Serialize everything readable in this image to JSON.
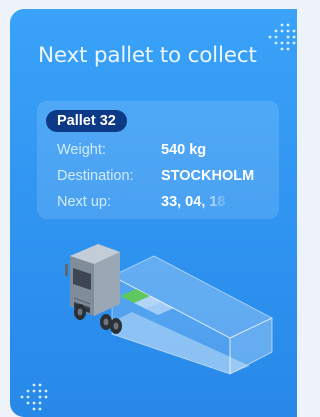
{
  "title": "Next pallet to collect",
  "pallet": {
    "badge": "Pallet 32",
    "rows": [
      {
        "label": "Weight:",
        "value": "540 kg"
      },
      {
        "label": "Destination:",
        "value": "STOCKHOLM"
      },
      {
        "label": "Next up:",
        "value": "33, 04, 18"
      }
    ]
  },
  "colors": {
    "background": "#2f93f0",
    "badge": "#0d3a86",
    "pallet_marker": "#5fc95f"
  },
  "icons": [
    "dots-pattern-icon",
    "truck-illustration"
  ]
}
